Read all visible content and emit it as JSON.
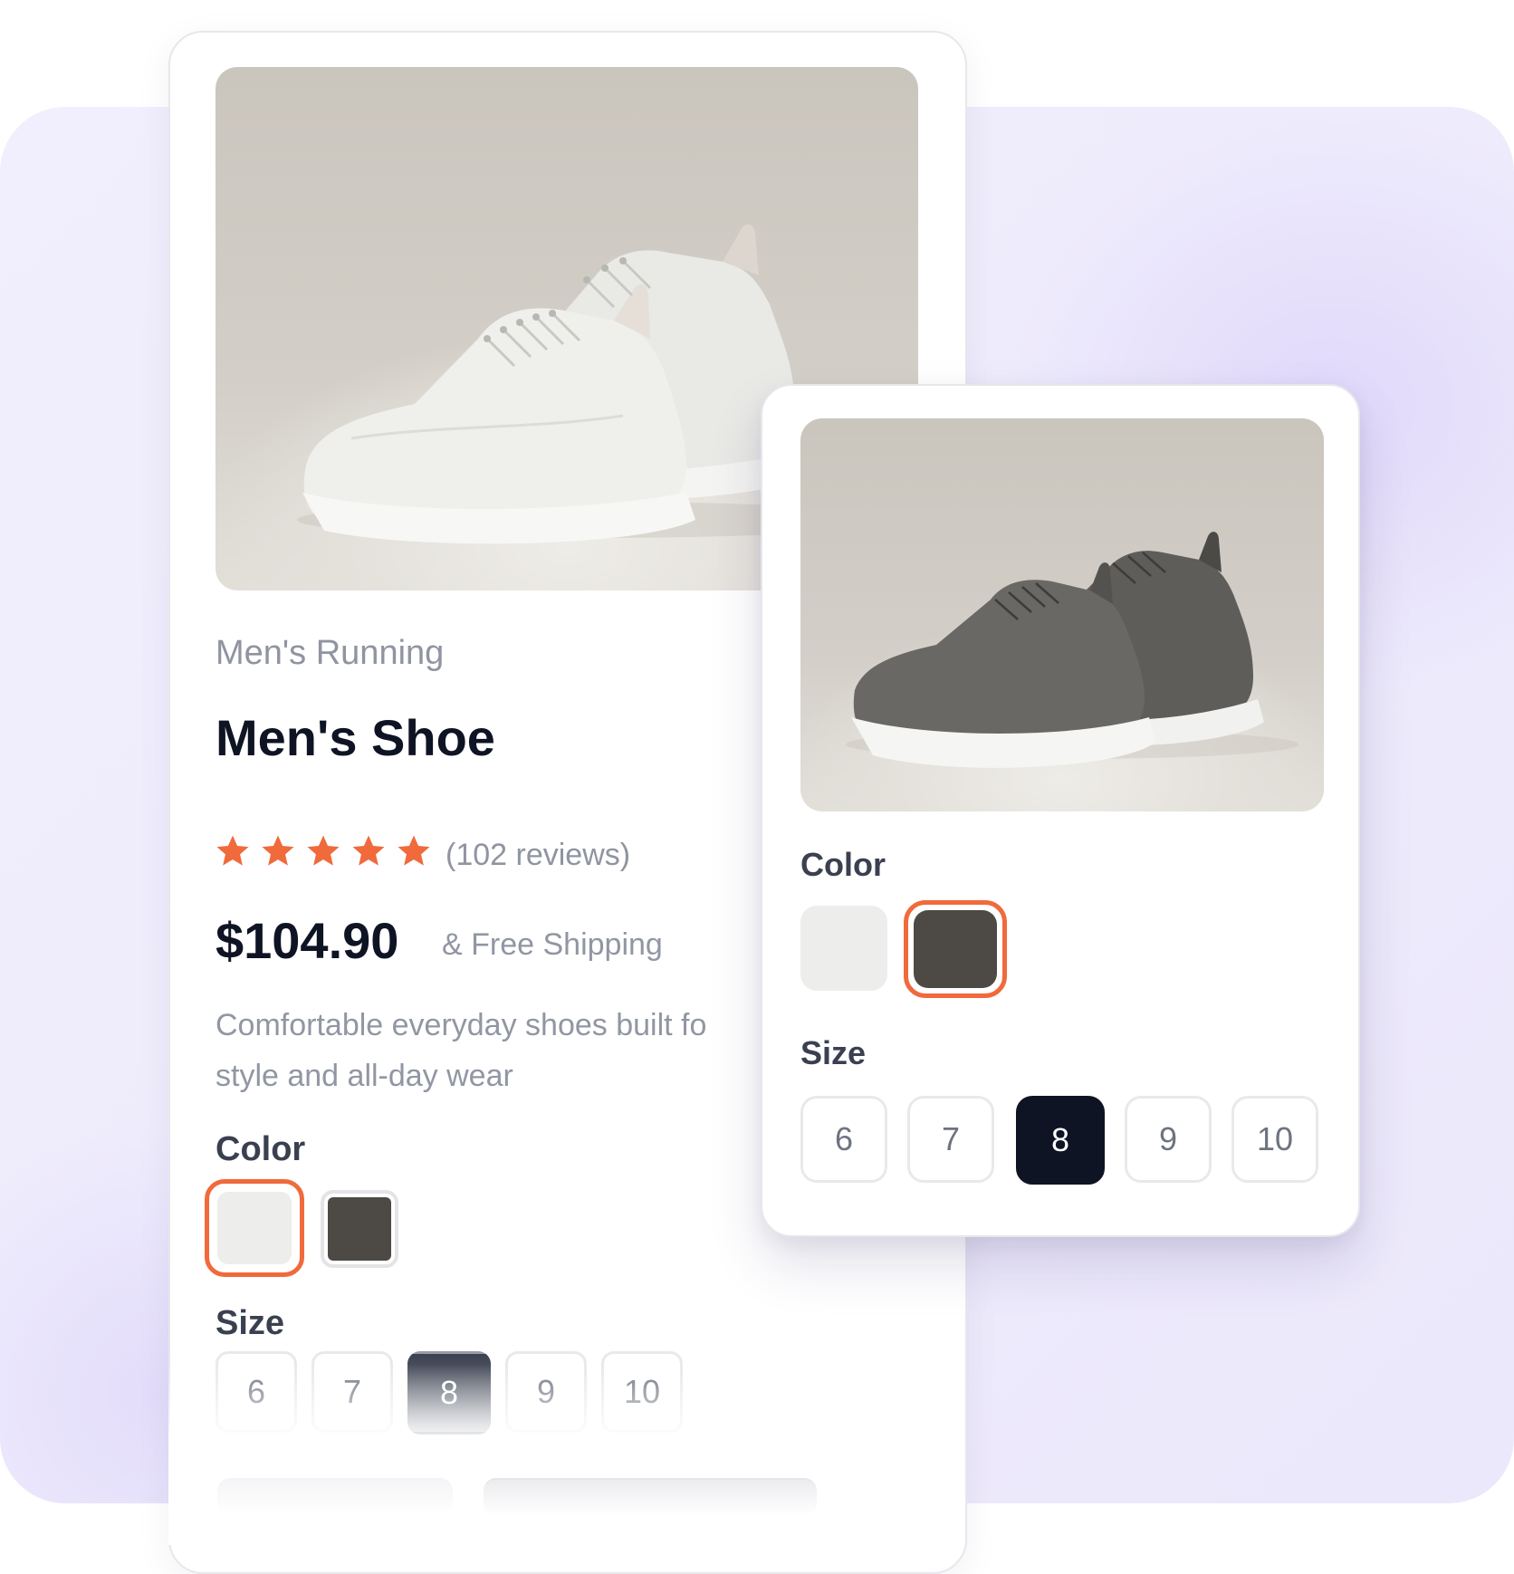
{
  "product": {
    "category": "Men's Running",
    "title": "Men's Shoe",
    "rating": 5,
    "reviews": "(102 reviews)",
    "price": "$104.90",
    "shipping": "& Free Shipping",
    "description": "Comfortable everyday shoes built fo\nstyle and all-day wear"
  },
  "options": {
    "color_label": "Color",
    "size_label": "Size",
    "colors": [
      "#ededec",
      "#4d4a45"
    ],
    "sizes": [
      "6",
      "7",
      "8",
      "9",
      "10"
    ]
  },
  "main_card": {
    "selected_color": "light",
    "selected_size": "8"
  },
  "variant_card": {
    "selected_color": "dark",
    "selected_size": "8"
  },
  "theme": {
    "accent": "#f06a3c",
    "text_dark": "#0f1424",
    "muted": "#8f94a0"
  }
}
